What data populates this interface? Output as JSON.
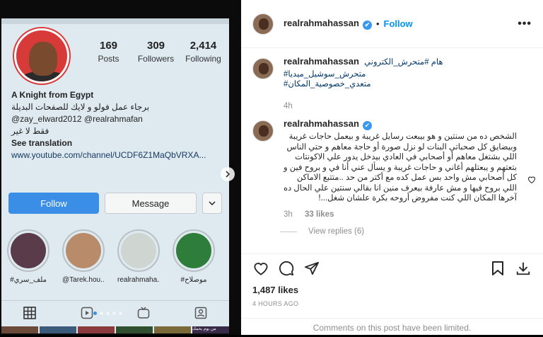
{
  "photo": {
    "profile": {
      "posts_count": "169",
      "posts_label": "Posts",
      "followers_count": "309",
      "followers_label": "Followers",
      "following_count": "2,414",
      "following_label": "Following",
      "name": "A Knight from Egypt",
      "bio_ar": "برجاء عمل فولو و لايك للصفحات البديلة",
      "mentions": "@zay_elward2012 @realrahmafan",
      "bio_ar2": "فقط لا غير",
      "see_translation": "See translation",
      "website": "www.youtube.com/channel/UCDF6Z1MaQbVRXA..."
    },
    "buttons": {
      "follow": "Follow",
      "message": "Message",
      "more": "⌄"
    },
    "highlights": [
      {
        "caption": "#ملف_سري",
        "color": "#5a3b4a"
      },
      {
        "caption": "@Tarek.hou...",
        "color": "#b88b6a"
      },
      {
        "caption": "realrahmaha...",
        "color": "#cfd6d2"
      },
      {
        "caption": "#موصلاح",
        "color": "#2e7d3a"
      }
    ],
    "thumb_caption": "من يوم يحمك"
  },
  "post": {
    "header": {
      "username": "realrahmahassan",
      "verified": "✔",
      "sep": "•",
      "follow": "Follow",
      "more": "•••"
    },
    "caption": {
      "username": "realrahmahassan",
      "line1": "هام #متحرش_الكتروني",
      "line2": "#متحرش_سوشيل_ميديا",
      "line3": "#متعدي_خصوصية_المكان",
      "time": "4h"
    },
    "comment": {
      "username": "realrahmahassan",
      "verified": "✔",
      "text": "الشخص ده من سنتين و هو بيبعت رسايل غريبة و بيعمل حاجات غريبة وبيضايق كل صحباتي البنات لو نزل صورة أو حاجة معاهم و حتي الناس اللي بشتغل معاهم أو أصحابي في العادي بيدخل يدور علي الاكونتات بتعتهم و يبعتلهم أغاني و حاجات غريبة و يسأل عني أنا في و بروح فين و كل أصحابي مش واحد بس عمل كده مع أكتر من حد ..متتبع الاماكن اللي بروح فيها و مش عارفة بيعرف منين انا بقالي سنتين علي الحال ده آخرها المكان اللي كنت مفروض أروحه بكرة علشان شغل...!",
      "time": "3h",
      "likes": "33 likes",
      "view_replies": "View replies (6)"
    },
    "likes": "1,487 likes",
    "ago": "4 HOURS AGO",
    "limited": "Comments on this post have been limited."
  }
}
